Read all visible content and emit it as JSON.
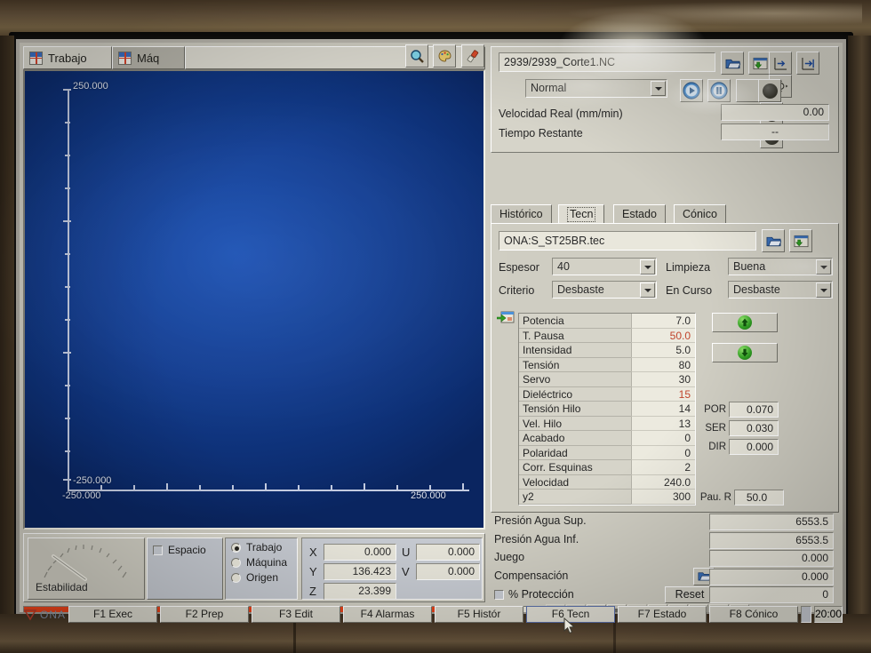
{
  "graphics": {
    "tabs": [
      {
        "label": "Trabajo",
        "icon": "crosshair-icon",
        "active": true
      },
      {
        "label": "Máq",
        "icon": "crosshair-icon",
        "active": false
      }
    ],
    "tools": [
      {
        "name": "zoom-icon",
        "glyph": "🔍"
      },
      {
        "name": "palette-icon",
        "glyph": "🎨"
      },
      {
        "name": "marker-icon",
        "glyph": "✎"
      }
    ],
    "axis": {
      "y_top": "250.000",
      "y_bottom": "-250.000",
      "x_left": "-250.000",
      "x_right": "250.000"
    },
    "background_color": "#143f93"
  },
  "program": {
    "path": "2939/2939_Corte1.NC",
    "mode": "Normal",
    "mode_options": [
      "Normal"
    ],
    "buttons": [
      {
        "name": "open-program-icon"
      },
      {
        "name": "save-program-icon"
      },
      {
        "name": "axis-start-icon"
      },
      {
        "name": "axis-end-icon"
      },
      {
        "name": "origin-move-icon"
      }
    ],
    "run_buttons": [
      {
        "name": "play-button"
      },
      {
        "name": "pause-button"
      }
    ],
    "lamps": 3,
    "velocidad_label": "Velocidad Real (mm/min)",
    "velocidad_value": "0.00",
    "tiempo_label": "Tiempo Restante",
    "tiempo_value": "--"
  },
  "tech_tabs": [
    {
      "label": "Histórico",
      "active": false
    },
    {
      "label": "Tecn",
      "active": true
    },
    {
      "label": "Estado",
      "active": false
    },
    {
      "label": "Cónico",
      "active": false
    }
  ],
  "tech": {
    "file": "ONA:S_ST25BR.tec",
    "file_buttons": [
      {
        "name": "open-tech-icon"
      },
      {
        "name": "save-tech-icon"
      }
    ],
    "fields": [
      {
        "label": "Espesor",
        "value": "40"
      },
      {
        "label": "Limpieza",
        "value": "Buena"
      },
      {
        "label": "Criterio",
        "value": "Desbaste"
      },
      {
        "label": "En Curso",
        "value": "Desbaste"
      }
    ],
    "table_icon": "import-params-icon",
    "parameters": [
      {
        "name": "Potencia",
        "value": "7.0",
        "highlight": false
      },
      {
        "name": "T. Pausa",
        "value": "50.0",
        "highlight": true
      },
      {
        "name": "Intensidad",
        "value": "5.0",
        "highlight": false
      },
      {
        "name": "Tensión",
        "value": "80",
        "highlight": false
      },
      {
        "name": "Servo",
        "value": "30",
        "highlight": false
      },
      {
        "name": "Dieléctrico",
        "value": "15",
        "highlight": true
      },
      {
        "name": "Tensión Hilo",
        "value": "14",
        "highlight": false
      },
      {
        "name": "Vel. Hilo",
        "value": "13",
        "highlight": false
      },
      {
        "name": "Acabado",
        "value": "0",
        "highlight": false
      },
      {
        "name": "Polaridad",
        "value": "0",
        "highlight": false
      },
      {
        "name": "Corr. Esquinas",
        "value": "2",
        "highlight": false
      },
      {
        "name": "Velocidad",
        "value": "240.0",
        "highlight": false
      },
      {
        "name": "y2",
        "value": "300",
        "highlight": false
      }
    ],
    "arrow_buttons": [
      {
        "name": "param-up-button"
      },
      {
        "name": "param-down-button"
      }
    ],
    "offsets": [
      {
        "label": "POR",
        "value": "0.070"
      },
      {
        "label": "SER",
        "value": "0.030"
      },
      {
        "label": "DIR",
        "value": "0.000"
      }
    ],
    "pausa_r": {
      "label": "Pau. R",
      "value": "50.0"
    }
  },
  "status_values": [
    {
      "label": "Presión Agua Sup.",
      "value": "6553.5"
    },
    {
      "label": "Presión Agua Inf.",
      "value": "6553.5"
    },
    {
      "label": "Juego",
      "value": "0.000"
    },
    {
      "label": "Compensación",
      "value": "0.000"
    }
  ],
  "proteccion": {
    "label": "% Protección",
    "checked": false,
    "reset_label": "Reset",
    "value": "0"
  },
  "stability": {
    "label": "Estabilidad"
  },
  "espacio": {
    "label": "Espacio",
    "checked": false
  },
  "coord_system": {
    "options": [
      {
        "label": "Trabajo",
        "selected": true
      },
      {
        "label": "Máquina",
        "selected": false
      },
      {
        "label": "Origen",
        "selected": false
      }
    ]
  },
  "coordinates": {
    "left": [
      {
        "axis": "X",
        "value": "0.000"
      },
      {
        "axis": "Y",
        "value": "136.423"
      },
      {
        "axis": "Z",
        "value": "23.399"
      }
    ],
    "right": [
      {
        "axis": "U",
        "value": "0.000"
      },
      {
        "axis": "V",
        "value": "0.000"
      }
    ]
  },
  "icon_strip": [
    {
      "name": "memory-icon",
      "dim": true
    },
    {
      "name": "ejes-icon",
      "dim": true
    },
    {
      "name": "wheel-icon",
      "dim": false
    },
    {
      "name": "clamp-icon",
      "dim": false
    },
    {
      "name": "prog-icon",
      "dim": true
    },
    {
      "name": "traffic-light-icon",
      "dim": false
    },
    {
      "name": "wire-cut-icon",
      "dim": false
    },
    {
      "name": "cloud-icon",
      "dim": false
    },
    {
      "name": "net-icon",
      "dim": false
    },
    {
      "name": "transfer-icon",
      "dim": false
    }
  ],
  "function_keys": [
    {
      "label": "F1 Exec",
      "active": false
    },
    {
      "label": "F2 Prep",
      "active": false
    },
    {
      "label": "F3 Edit",
      "active": false
    },
    {
      "label": "F4 Alarmas",
      "active": false
    },
    {
      "label": "F5 Histór",
      "active": false
    },
    {
      "label": "F6 Tecn",
      "active": true
    },
    {
      "label": "F7 Estado",
      "active": false
    },
    {
      "label": "F8 Cónico",
      "active": false
    }
  ],
  "brand": "ONA",
  "clock": "20:00",
  "colors": {
    "alarm_bar": "#d93c15",
    "accent_blue": "#143f93",
    "highlight_text": "#c0442c",
    "green": "#2f9e22"
  }
}
